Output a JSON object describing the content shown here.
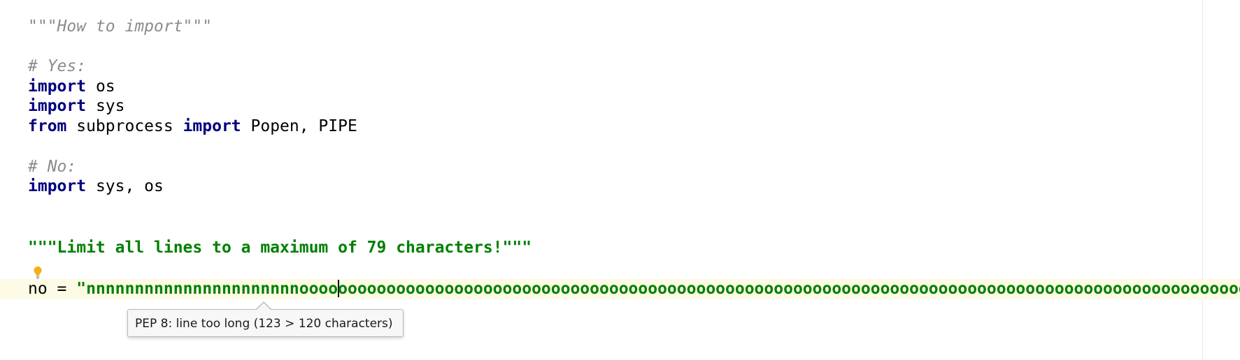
{
  "editor": {
    "lines": [
      {
        "id": "l1",
        "tokens": [
          {
            "text": "\"\"\"How to import\"\"\"",
            "style": "comment"
          }
        ]
      },
      {
        "id": "l2",
        "tokens": [
          {
            "text": "# Yes:",
            "style": "comment"
          }
        ]
      },
      {
        "id": "l3",
        "tokens": [
          {
            "text": "import",
            "style": "keyword"
          },
          {
            "text": " os",
            "style": "plain"
          }
        ]
      },
      {
        "id": "l4",
        "tokens": [
          {
            "text": "import",
            "style": "keyword"
          },
          {
            "text": " sys",
            "style": "plain"
          }
        ]
      },
      {
        "id": "l5",
        "tokens": [
          {
            "text": "from",
            "style": "keyword"
          },
          {
            "text": " subprocess ",
            "style": "plain"
          },
          {
            "text": "import",
            "style": "keyword"
          },
          {
            "text": " Popen, PIPE",
            "style": "plain"
          }
        ]
      },
      {
        "id": "l6",
        "tokens": [
          {
            "text": "# No:",
            "style": "comment"
          }
        ]
      },
      {
        "id": "l7",
        "tokens": [
          {
            "text": "import",
            "style": "keyword"
          },
          {
            "text": " sys, os",
            "style": "plain"
          }
        ]
      },
      {
        "id": "l8",
        "tokens": [
          {
            "text": "\"\"\"Limit all lines to a maximum of 79 characters!\"\"\"",
            "style": "string-bold"
          }
        ]
      },
      {
        "id": "l9",
        "tokens": [
          {
            "text": "no = ",
            "style": "plain"
          },
          {
            "text": "\"nnnnnnnnnnnnnnnnnnnnnnoooo",
            "style": "string-bold"
          },
          {
            "text": "",
            "style": "caret"
          },
          {
            "text": "oooooooooooooooooooooooooooooooooooooooooooooooooooooooooooooooooooooooooooooooooooooooooooooo\"",
            "style": "string-bold"
          }
        ]
      }
    ],
    "inspection_tooltip": "PEP 8: line too long (123 > 120 characters)",
    "bulb_icon": "intention-bulb-icon",
    "colors": {
      "keyword": "#000080",
      "comment": "#8c8c8c",
      "string": "#008000",
      "caret_row": "#fdfbe6",
      "bulb": "#f2b015"
    }
  }
}
